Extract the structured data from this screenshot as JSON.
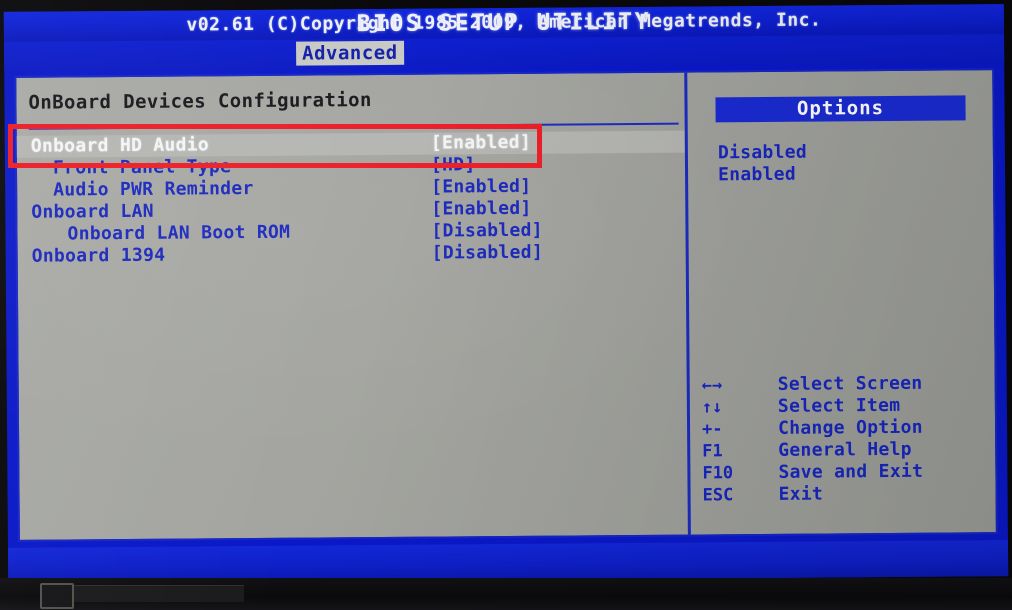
{
  "header": {
    "title": "BIOS SETUP UTILITY",
    "active_tab": "Advanced"
  },
  "main": {
    "section_title": "OnBoard Devices Configuration",
    "settings": [
      {
        "label": "Onboard HD Audio",
        "value": "[Enabled]",
        "indent": 0,
        "selected": true
      },
      {
        "label": "Front Panel Type",
        "value": "[HD]",
        "indent": 1,
        "selected": false
      },
      {
        "label": "Audio PWR Reminder",
        "value": "[Enabled]",
        "indent": 1,
        "selected": false
      },
      {
        "label": "Onboard LAN",
        "value": "[Enabled]",
        "indent": 0,
        "selected": false
      },
      {
        "label": "Onboard LAN Boot ROM",
        "value": "[Disabled]",
        "indent": 2,
        "selected": false
      },
      {
        "label": "Onboard 1394",
        "value": "[Disabled]",
        "indent": 0,
        "selected": false
      }
    ]
  },
  "options_panel": {
    "header": "Options",
    "items": [
      "Disabled",
      "Enabled"
    ]
  },
  "legend": [
    {
      "key": "←→",
      "desc": "Select Screen"
    },
    {
      "key": "↑↓",
      "desc": "Select Item"
    },
    {
      "key": "+-",
      "desc": "Change Option"
    },
    {
      "key": "F1",
      "desc": "General Help"
    },
    {
      "key": "F10",
      "desc": "Save and Exit"
    },
    {
      "key": "ESC",
      "desc": "Exit"
    }
  ],
  "footer": {
    "text": "v02.61 (C)Copyright 1985-2009, American Megatrends, Inc."
  },
  "colors": {
    "header_blue": "#0d1fcd",
    "panel_gray": "#a5a6a1",
    "text_blue": "#1826bd",
    "selected_text": "#f4f5f7",
    "annotation_red": "#ec1c24"
  }
}
